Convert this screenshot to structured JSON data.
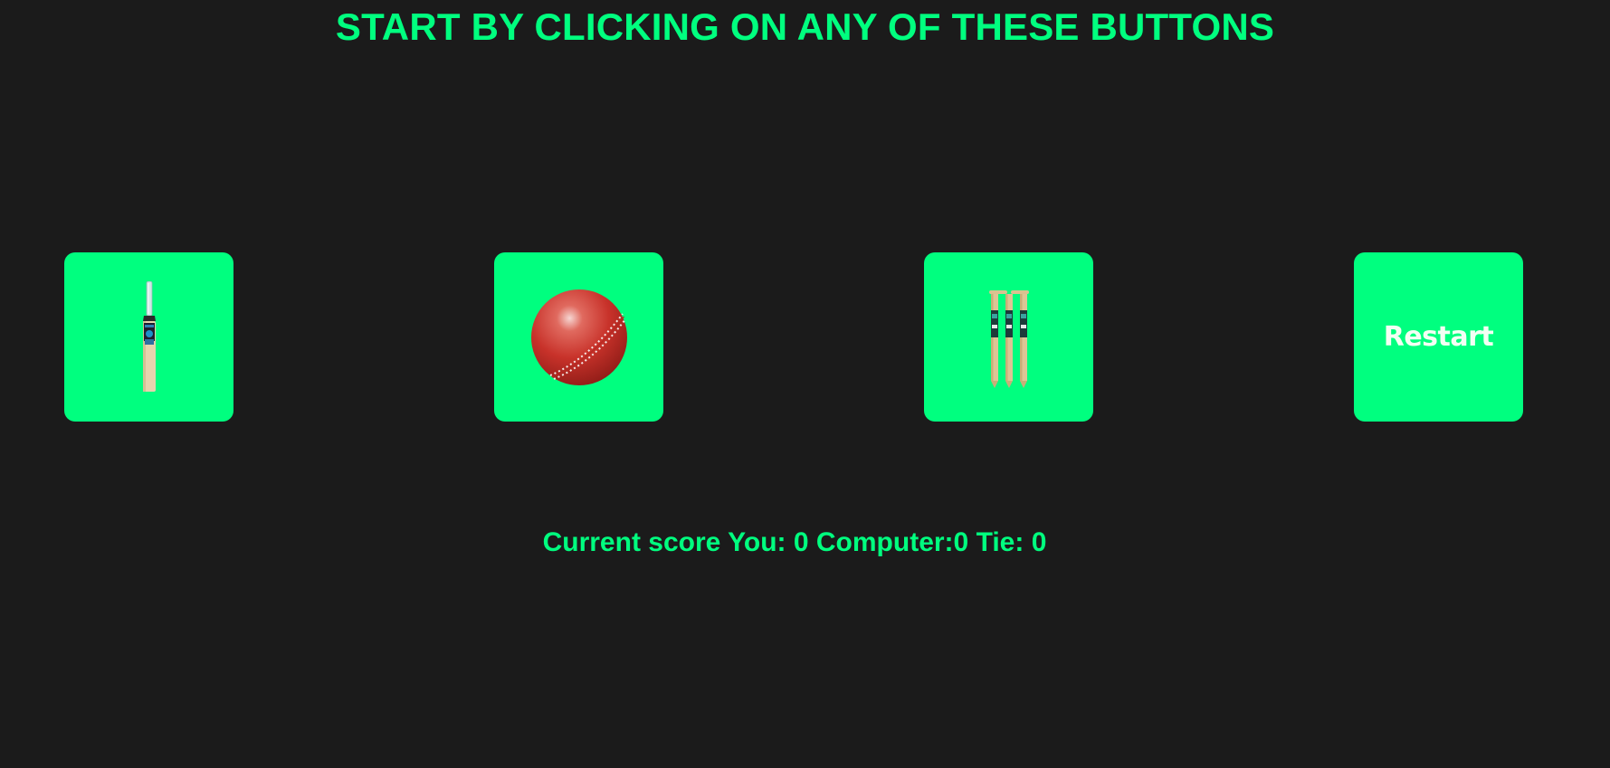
{
  "heading": "START BY CLICKING ON ANY OF THESE BUTTONS",
  "buttons": {
    "bat": {
      "icon": "cricket-bat-icon"
    },
    "ball": {
      "icon": "cricket-ball-icon"
    },
    "stumps": {
      "icon": "cricket-stumps-icon"
    },
    "restart": {
      "label": "Restart"
    }
  },
  "score": {
    "text": "Current score You: 0 Computer:0 Tie: 0"
  },
  "colors": {
    "background": "#1b1b1b",
    "accent": "#00ff7f",
    "button_text": "#f4fff4",
    "ball_red": "#c8322a"
  }
}
